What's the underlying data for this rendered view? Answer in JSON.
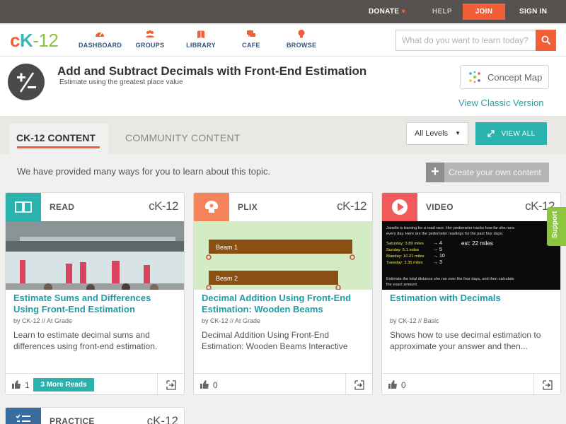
{
  "topbar": {
    "donate": "DONATE",
    "help": "HELP",
    "join": "JOIN",
    "signin": "SIGN IN"
  },
  "nav": {
    "logo_c": "c",
    "logo_k": "K",
    "logo_n": "-12",
    "items": [
      {
        "label": "DASHBOARD",
        "icon": "dashboard-gauge-icon"
      },
      {
        "label": "GROUPS",
        "icon": "groups-people-icon"
      },
      {
        "label": "LIBRARY",
        "icon": "library-book-icon"
      },
      {
        "label": "CAFE",
        "icon": "cafe-chat-icon"
      },
      {
        "label": "BROWSE",
        "icon": "browse-lightbulb-icon"
      }
    ],
    "search_placeholder": "What do you want to learn today?"
  },
  "header": {
    "title": "Add and Subtract Decimals with Front-End Estimation",
    "subtitle": "Estimate using the greatest place value",
    "concept_map": "Concept Map",
    "classic": "View Classic Version"
  },
  "tabs": {
    "active": "CK-12 CONTENT",
    "inactive": "COMMUNITY CONTENT",
    "levels": "All Levels",
    "view_all": "VIEW ALL"
  },
  "intro": {
    "provided": "We have provided many ways for you to learn about this topic.",
    "create": "Create your own content"
  },
  "brand": "cK-12",
  "cards": [
    {
      "type": "READ",
      "title": "Estimate Sums and Differences Using Front-End Estimation",
      "meta": "by CK-12 // At Grade",
      "desc": "Learn to estimate decimal sums and differences using front-end estimation.",
      "likes": "1",
      "more": "3 More Reads",
      "color": "#2bb1ae"
    },
    {
      "type": "PLIX",
      "title": "Decimal Addition Using Front-End Estimation: Wooden Beams",
      "meta": "by CK-12 // At Grade",
      "desc": "Decimal Addition Using Front-End Estimation: Wooden Beams Interactive",
      "likes": "0",
      "beam1": "Beam 1",
      "beam2": "Beam 2",
      "color": "#f4855b"
    },
    {
      "type": "VIDEO",
      "title": "Estimation with Decimals",
      "meta": "by CK-12 // Basic",
      "desc": "Shows how to use decimal estimation to approximate your answer and then...",
      "likes": "0",
      "color": "#f05a5a",
      "board": {
        "line1": "Janelle is training for a road race. Her pedometer tracks how far she runs",
        "line2": "every day. Here are the pedometer readings for the past four days:",
        "rows": [
          "Saturday: 3.89 miles",
          "Sunday: 5.1 miles",
          "Monday: 10.21 miles",
          "Tuesday: 3.35 miles"
        ],
        "approx": [
          "→ 4",
          "→ 5",
          "→ 10",
          "→ 3"
        ],
        "sum": "est: 22 miles",
        "bottom1": "Estimate the total distance she ran over the four days, and then calculate",
        "bottom2": "the exact amount."
      }
    }
  ],
  "practice": {
    "type": "PRACTICE"
  },
  "support": "Support"
}
